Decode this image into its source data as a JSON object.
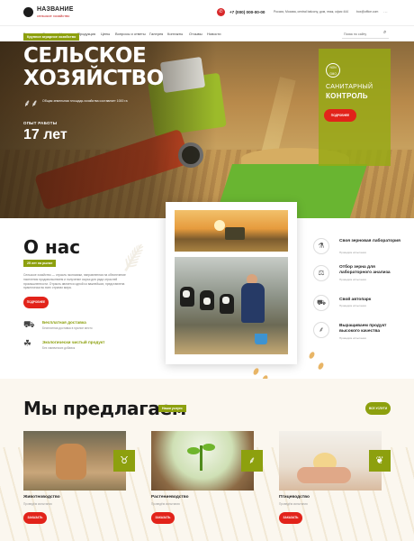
{
  "header": {
    "logo_title": "НАЗВАНИЕ",
    "logo_subtitle": "сельское хозяйство",
    "phone": "+7 (000) 000-00-00",
    "address": "Россия, Москва, central balcony, дом, этаж, офис 444",
    "email": "box@office.com",
    "more_icon": "more-icon"
  },
  "nav": {
    "items": [
      "Главная",
      "О нас",
      "Услуги",
      "Продукция",
      "Цены",
      "Вопросы и ответы",
      "Галерея",
      "Контакты",
      "Отзывы",
      "Новости"
    ],
    "search_placeholder": "Поиск по сайту",
    "search_icon": "search-icon"
  },
  "hero": {
    "badge": "Крупное аграрное хозяйство",
    "title_line1": "СЕЛЬСКОЕ",
    "title_line2": "ХОЗЯЙСТВО",
    "tagline": "Общая земельная площадь хозяйства составляет 1000 га",
    "experience_label": "ОПЫТ РАБОТЫ",
    "experience_value": "17 лет",
    "sanitary_logo": "NON GMO",
    "sanitary_line1": "САНИТАРНЫЙ",
    "sanitary_line2": "КОНТРОЛЬ",
    "sanitary_button": "ПОДРОБНЕЕ"
  },
  "about": {
    "title": "О нас",
    "badge": "25 лет на рынке",
    "text": "Сельское хозяйство — отрасль экономики, направленная на обеспечение населения продовольствием и получение сырья для ряда отраслей промышленности. Отрасль является одной из важнейших, представлена практически во всех странах мира.",
    "button": "ПОДРОБНЕЕ",
    "features": [
      {
        "title": "Бесплатная доставка",
        "sub": "Бесплатная доставка в нужное место"
      },
      {
        "title": "Экологически чистый продукт",
        "sub": "Без химических добавок"
      }
    ]
  },
  "services": [
    {
      "title": "Своя зерновая лаборатория",
      "sub": "Проведём испытания"
    },
    {
      "title": "Отбор зерна для лабораторного анализа",
      "sub": "Проведём испытания"
    },
    {
      "title": "Свой автопарк",
      "sub": "Проведём испытания"
    },
    {
      "title": "Выращиваем продукт высокого качества",
      "sub": "Проведём испытания"
    }
  ],
  "offers": {
    "title": "Мы предлагаем",
    "badge": "Наши услуги",
    "all_button": "ВСЕ УСЛУГИ",
    "cards": [
      {
        "title": "Животноводство",
        "sub": "Проведём испытания",
        "button": "ЗАКАЗАТЬ",
        "icon": "cow-icon"
      },
      {
        "title": "Растениеводство",
        "sub": "Проведём испытания",
        "button": "ЗАКАЗАТЬ",
        "icon": "sprout-icon"
      },
      {
        "title": "Птицеводство",
        "sub": "Проведём испытания",
        "button": "ЗАКАЗАТЬ",
        "icon": "bird-icon"
      }
    ]
  },
  "colors": {
    "accent_green": "#8da00e",
    "accent_red": "#e2231a"
  }
}
